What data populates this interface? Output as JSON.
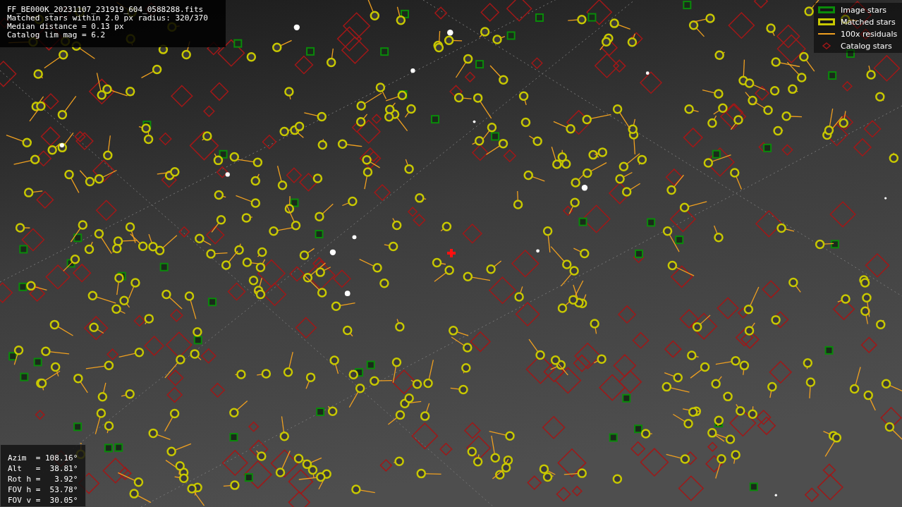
{
  "info": {
    "lines": [
      "FF_BE000K_20231107_231919_604_0588288.fits",
      "Matched stars within 2.0 px radius: 320/370",
      "Median distance = 0.13 px",
      "Catalog lim mag = 6.2"
    ]
  },
  "legend": [
    {
      "kind": "image",
      "label": "Image stars"
    },
    {
      "kind": "matched",
      "label": "Matched stars"
    },
    {
      "kind": "residual",
      "label": "100x residuals"
    },
    {
      "kind": "catalog",
      "label": "Catalog stars"
    }
  ],
  "pointing": {
    "lines": [
      "Azim  = 108.16°",
      "Alt   =  38.81°",
      "Rot h =   3.92°",
      "FOV h =  53.78°",
      "FOV v =  30.05°"
    ]
  }
}
